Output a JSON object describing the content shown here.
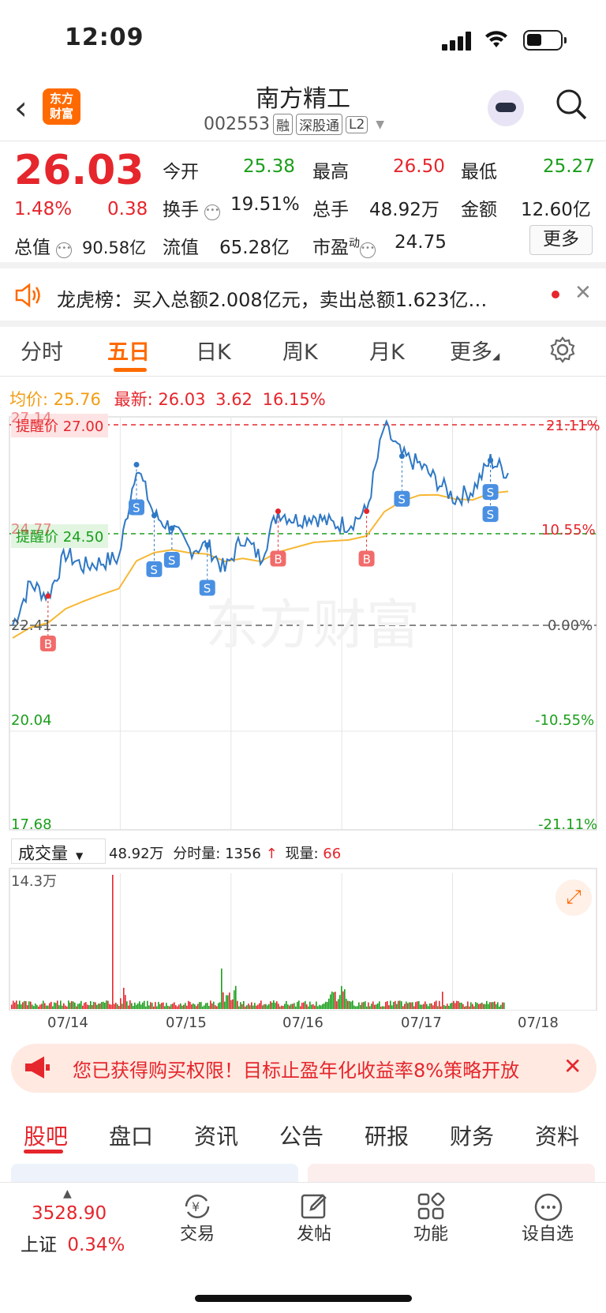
{
  "status": {
    "time": "12:09"
  },
  "header": {
    "logo_top": "东方",
    "logo_bottom": "财富",
    "name": "南方精工",
    "code": "002553",
    "tags": [
      "融",
      "深股通",
      "L2"
    ]
  },
  "quote": {
    "price": "26.03",
    "change_pct": "1.48%",
    "change": "0.38",
    "open_label": "今开",
    "open": "25.38",
    "high_label": "最高",
    "high": "26.50",
    "low_label": "最低",
    "low": "25.27",
    "turnover_label": "换手",
    "turnover": "19.51%",
    "volume_label": "总手",
    "volume": "48.92万",
    "amount_label": "金额",
    "amount": "12.60亿",
    "mktcap_label": "总值",
    "mktcap": "90.58亿",
    "float_label": "流值",
    "float": "65.28亿",
    "pe_label": "市盈",
    "pe_sup": "动",
    "pe": "24.75",
    "more_label": "更多"
  },
  "notice": {
    "text": "龙虎榜：买入总额2.008亿元，卖出总额1.623亿…"
  },
  "tabs": [
    {
      "label": "分时"
    },
    {
      "label": "五日"
    },
    {
      "label": "日K"
    },
    {
      "label": "周K"
    },
    {
      "label": "月K"
    },
    {
      "label": "更多"
    }
  ],
  "chart_info": {
    "avg_label": "均价:",
    "avg": "25.76",
    "latest_label": "最新:",
    "latest": "26.03",
    "chg": "3.62",
    "chg_pct": "16.15%",
    "y_top": "27.14",
    "y_alert_high": "27.00",
    "alert_high_label": "提醒价",
    "y_mid": "24.77",
    "y_alert_low": "24.50",
    "alert_low_label": "提醒价",
    "y_base": "22.41",
    "y_low1": "20.04",
    "y_low2": "17.68",
    "pct_top": "21.11%",
    "pct_mid": "10.55%",
    "pct_base": "0.00%",
    "pct_low1": "-10.55%",
    "pct_low2": "-21.11%",
    "watermark": "东方财富"
  },
  "volume_info": {
    "selector": "成交量",
    "total": "48.92万",
    "tick_label": "分时量:",
    "tick": "1356",
    "now_label": "现量:",
    "now": "66",
    "max": "14.3万"
  },
  "chart_data": {
    "type": "line",
    "x": [
      "07/14",
      "07/15",
      "07/16",
      "07/17",
      "07/18"
    ],
    "ylim": [
      17.68,
      29.6
    ],
    "base_price": 22.41,
    "series": [
      {
        "name": "",
        "values": [
          22.41,
          23.4,
          23.1,
          24.1,
          23.8,
          23.9,
          24.0,
          26.2,
          25.0,
          24.7,
          24.2,
          24.3,
          23.7,
          24.5,
          24.0,
          25.1,
          24.9,
          25.0,
          24.8,
          24.8,
          25.1,
          27.1,
          26.4,
          26.2,
          25.8,
          25.4,
          25.6,
          26.3,
          26.0
        ]
      }
    ],
    "trade_marks": [
      "B",
      "S",
      "S",
      "S",
      "S",
      "B",
      "B",
      "S",
      "S",
      "S"
    ],
    "volume_dates": [
      "07/14",
      "07/15",
      "07/16",
      "07/17",
      "07/18"
    ]
  },
  "promo": {
    "text": "您已获得购买权限！目标止盈年化收益率8%策略开放"
  },
  "bottom_tabs": [
    {
      "label": "股吧"
    },
    {
      "label": "盘口"
    },
    {
      "label": "资讯"
    },
    {
      "label": "公告"
    },
    {
      "label": "研报"
    },
    {
      "label": "财务"
    },
    {
      "label": "资料"
    }
  ],
  "footer": {
    "index_value": "3528.90",
    "index_name": "上证",
    "index_pct": "0.34%",
    "items": [
      {
        "label": "交易",
        "icon": "trade-icon"
      },
      {
        "label": "发帖",
        "icon": "edit-icon"
      },
      {
        "label": "功能",
        "icon": "grid-icon"
      },
      {
        "label": "设自选",
        "icon": "more-icon"
      }
    ]
  }
}
